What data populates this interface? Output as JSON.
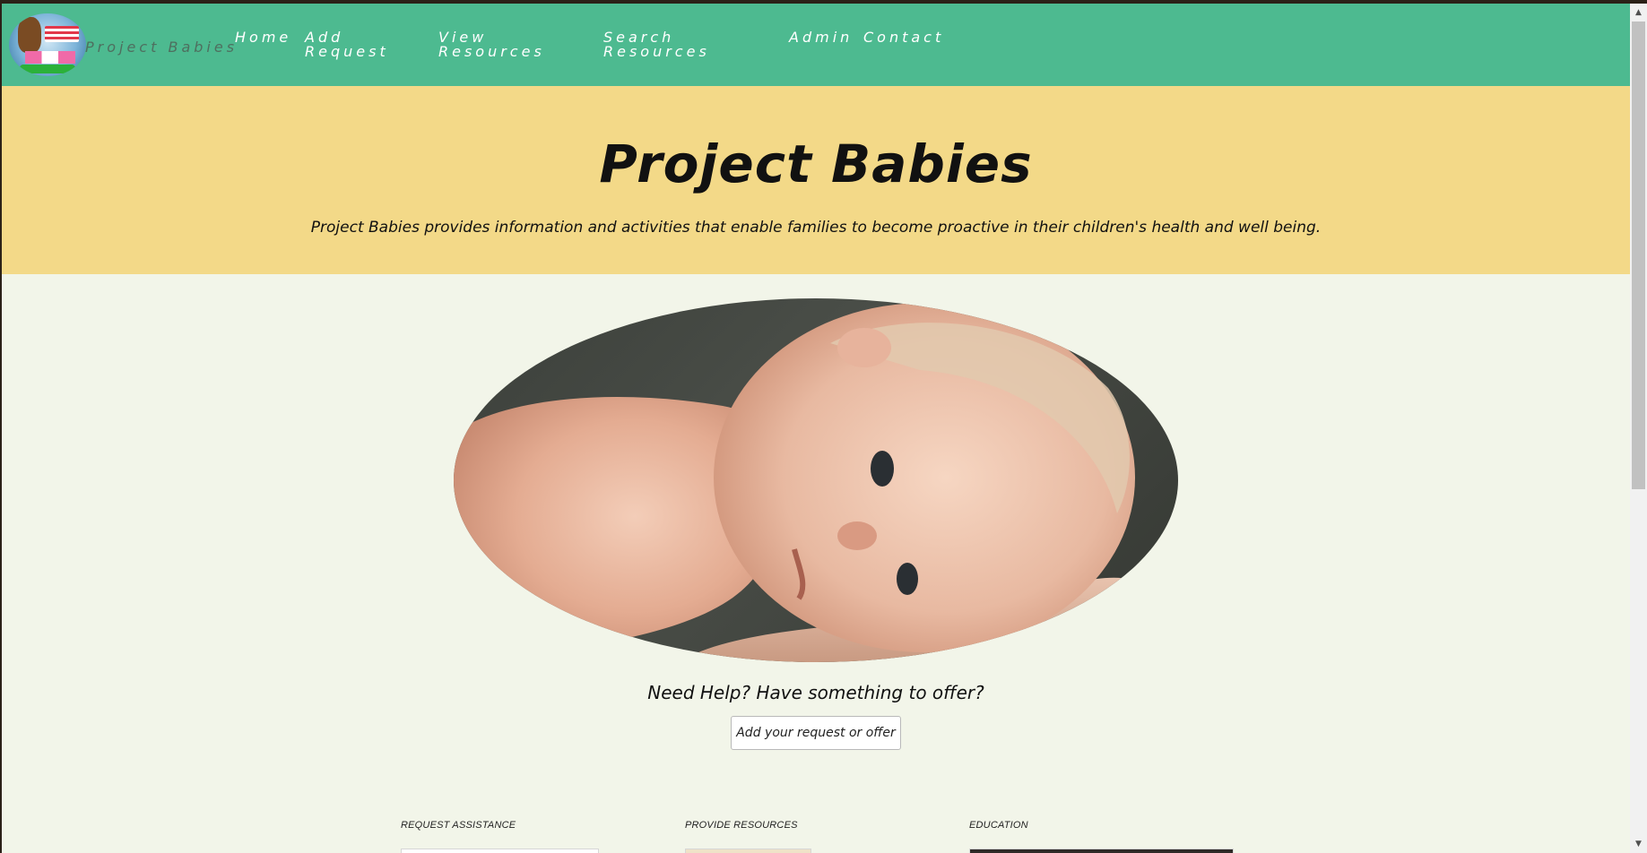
{
  "navbar": {
    "brand": "Project Babies",
    "links": [
      {
        "line1": "Home",
        "line2": ""
      },
      {
        "line1": "Add",
        "line2": "Request"
      },
      {
        "line1": "View",
        "line2": "Resources"
      },
      {
        "line1": "Search",
        "line2": "Resources"
      },
      {
        "line1": "Admin",
        "line2": ""
      },
      {
        "line1": "Contact",
        "line2": ""
      }
    ],
    "colors": {
      "background": "#4dba90",
      "brand_text": "#4e6f5f",
      "link_text": "#ffffff"
    }
  },
  "hero": {
    "title": "Project Babies",
    "subtitle": "Project Babies provides information and activities that enable families to become proactive in their children's health and well being.",
    "background": "#f3d988"
  },
  "main": {
    "image_icon": "baby-photo",
    "cta_text": "Need Help? Have something to offer?",
    "cta_button": "Add your request or offer",
    "sections": [
      {
        "label": "REQUEST ASSISTANCE"
      },
      {
        "label": "PROVIDE RESOURCES"
      },
      {
        "label": "EDUCATION"
      }
    ],
    "background": "#f2f5e9"
  },
  "scrollbar": {
    "up_icon": "▲",
    "down_icon": "▼"
  }
}
